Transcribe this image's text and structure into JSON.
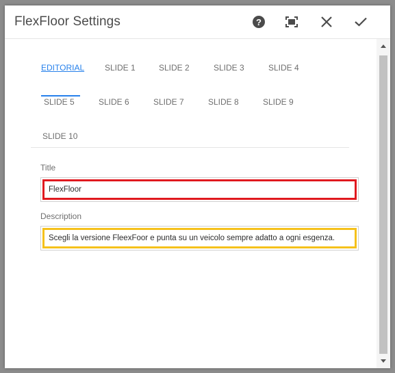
{
  "dialog": {
    "title": "FlexFloor Settings",
    "icons": {
      "help": "help-icon",
      "fullscreen": "fullscreen-icon",
      "close": "close-icon",
      "confirm": "checkmark-icon"
    }
  },
  "tabs": [
    {
      "label": "EDITORIAL",
      "active": true
    },
    {
      "label": "SLIDE 1"
    },
    {
      "label": "SLIDE 2"
    },
    {
      "label": "SLIDE 3"
    },
    {
      "label": "SLIDE 4"
    },
    {
      "label": "SLIDE 5"
    },
    {
      "label": "SLIDE 6"
    },
    {
      "label": "SLIDE 7"
    },
    {
      "label": "SLIDE 8"
    },
    {
      "label": "SLIDE 9"
    },
    {
      "label": "SLIDE 10"
    }
  ],
  "form": {
    "title_label": "Title",
    "title_value": "FlexFloor",
    "description_label": "Description",
    "description_value": "Scegli la versione FleexFoor e punta su un veicolo sempre adatto a ogni esgenza."
  },
  "colors": {
    "accent": "#2680eb",
    "title_highlight": "#e0191f",
    "description_highlight": "#f5c11b"
  }
}
